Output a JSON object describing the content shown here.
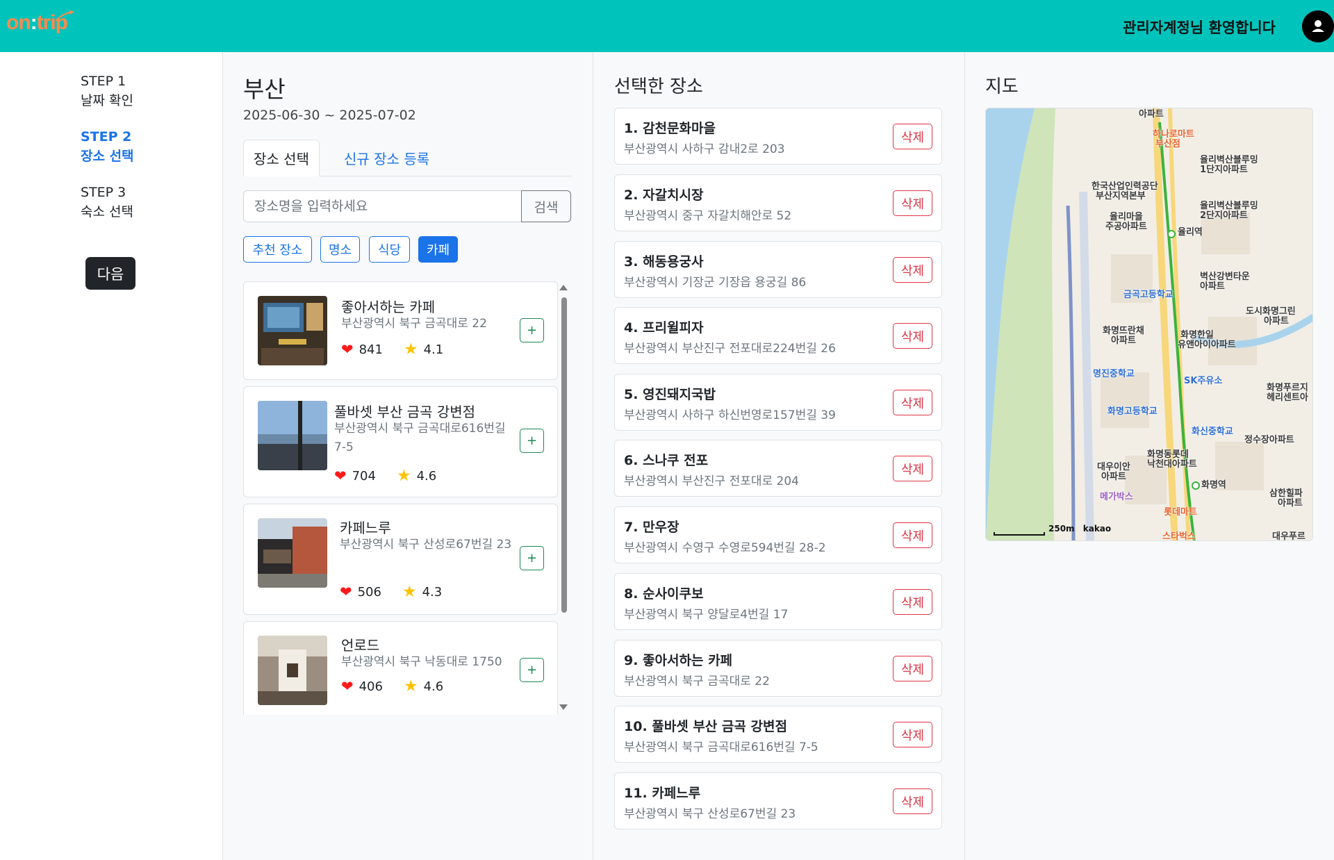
{
  "header": {
    "logo_on": "on",
    "logo_colon": ":",
    "logo_trip": "trip",
    "welcome": "관리자계정님 환영합니다",
    "brand_color": "#00c4bc",
    "logo_color": "#ff8a4c"
  },
  "steps": [
    {
      "step": "STEP 1",
      "label": "날짜 확인",
      "active": false
    },
    {
      "step": "STEP 2",
      "label": "장소 선택",
      "active": true
    },
    {
      "step": "STEP 3",
      "label": "숙소 선택",
      "active": false
    }
  ],
  "next_button": "다음",
  "planner": {
    "city": "부산",
    "dates": "2025-06-30 ~ 2025-07-02",
    "tabs": {
      "select": "장소 선택",
      "register": "신규 장소 등록"
    },
    "search": {
      "placeholder": "장소명을 입력하세요",
      "button": "검색"
    },
    "chips": [
      {
        "label": "추천 장소",
        "active": false
      },
      {
        "label": "명소",
        "active": false
      },
      {
        "label": "식당",
        "active": false
      },
      {
        "label": "카페",
        "active": true
      }
    ],
    "results": [
      {
        "name": "좋아서하는 카페",
        "address": "부산광역시 북구 금곡대로 22",
        "likes": "841",
        "rating": "4.1",
        "add": "+"
      },
      {
        "name": "풀바셋 부산 금곡 강변점",
        "address": "부산광역시 북구 금곡대로616번길 7-5",
        "likes": "704",
        "rating": "4.6",
        "add": "+"
      },
      {
        "name": "카페느루",
        "address": "부산광역시 북구 산성로67번길 23",
        "likes": "506",
        "rating": "4.3",
        "add": "+"
      },
      {
        "name": "언로드",
        "address": "부산광역시 북구 낙동대로 1750",
        "likes": "406",
        "rating": "4.6",
        "add": "+"
      }
    ]
  },
  "selected": {
    "title": "선택한 장소",
    "delete_label": "삭제",
    "items": [
      {
        "name": "1. 감천문화마을",
        "address": "부산광역시 사하구 감내2로 203"
      },
      {
        "name": "2. 자갈치시장",
        "address": "부산광역시 중구 자갈치해안로 52"
      },
      {
        "name": "3. 해동용궁사",
        "address": "부산광역시 기장군 기장읍 용궁길 86"
      },
      {
        "name": "4. 프리윌피자",
        "address": "부산광역시 부산진구 전포대로224번길 26"
      },
      {
        "name": "5. 영진돼지국밥",
        "address": "부산광역시 사하구 하신번영로157번길 39"
      },
      {
        "name": "6. 스나쿠 전포",
        "address": "부산광역시 부산진구 전포대로 204"
      },
      {
        "name": "7. 만우장",
        "address": "부산광역시 수영구 수영로594번길 28-2"
      },
      {
        "name": "8. 순사이쿠보",
        "address": "부산광역시 북구 양달로4번길 17"
      },
      {
        "name": "9. 좋아서하는 카페",
        "address": "부산광역시 북구 금곡대로 22"
      },
      {
        "name": "10. 풀바셋 부산 금곡 강변점",
        "address": "부산광역시 북구 금곡대로616번길 7-5"
      },
      {
        "name": "11. 카페느루",
        "address": "부산광역시 북구 산성로67번길 23"
      }
    ]
  },
  "map": {
    "title": "지도",
    "scale": "250m",
    "attribution": "kakao",
    "labels": [
      "아파트",
      "하나로마트",
      "부산점",
      "율리벽산블루밍",
      "1단지아파트",
      "한국산업인력공단",
      "부산지역본부",
      "율리벽산블루밍",
      "2단지아파트",
      "율리마을",
      "주공아파트",
      "율리역",
      "벽산강변타운",
      "아파트",
      "금곡고등학교",
      "도시화명그린",
      "아파트",
      "화명뜨란채",
      "아파트",
      "화명한일",
      "유앤아이아파트",
      "명진중학교",
      "SK주유소",
      "화명푸르지",
      "헤리센트아",
      "화명고등학교",
      "화신중학교",
      "정수장아파트",
      "화명동롯데",
      "낙천대아파트",
      "대우이안",
      "아파트",
      "화명역",
      "메가박스",
      "롯데마트",
      "삼한힐파",
      "아파트",
      "스타벅스",
      "대우푸르"
    ]
  }
}
